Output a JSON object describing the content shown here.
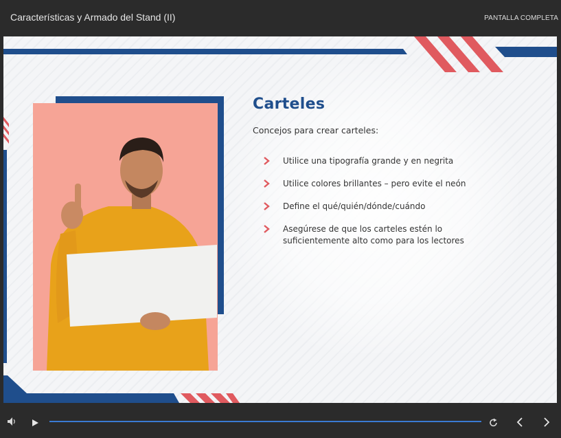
{
  "header": {
    "title": "Características y Armado del Stand (II)",
    "fullscreen_label": "PANTALLA COMPLETA"
  },
  "slide": {
    "heading": "Carteles",
    "intro": "Concejos para crear carteles:",
    "bullets": [
      "Utilice una tipografía grande y en negrita",
      "Utilice colores brillantes – pero evite el neón",
      "Define el qué/quién/dónde/cuándo",
      "Asegúrese de que los carteles estén lo suficientemente alto como para los lectores"
    ],
    "accent_blue": "#1f4e8c",
    "accent_red": "#e05a5f"
  },
  "controls": {
    "volume_icon": "volume-icon",
    "play_icon": "play-icon",
    "replay_icon": "replay-icon",
    "prev_icon": "chevron-left-icon",
    "next_icon": "chevron-right-icon",
    "progress_color": "#3a7bd5"
  }
}
